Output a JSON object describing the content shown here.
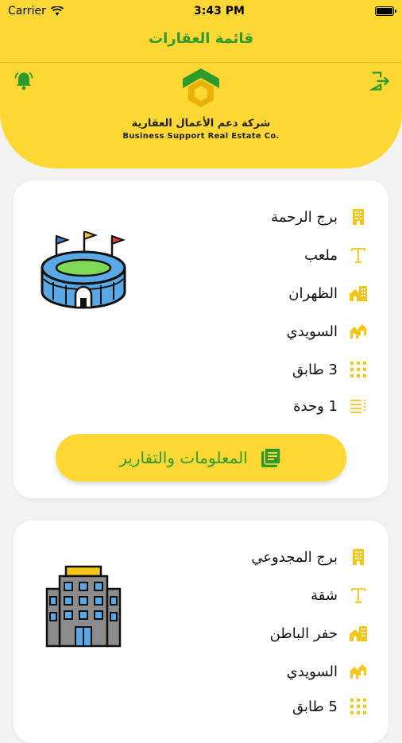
{
  "status": {
    "carrier": "Carrier",
    "time": "3:43 PM"
  },
  "header": {
    "title": "قائمة العقارات",
    "company_ar": "شركة دعم الأعمال العقارية",
    "company_en": "Business Support Real Estate Co."
  },
  "properties": [
    {
      "name": "برج الرحمة",
      "type": "ملعب",
      "district": "الظهران",
      "area": "السويدي",
      "floors": "3 طابق",
      "units": "1 وحدة",
      "button_label": "المعلومات والتقارير"
    },
    {
      "name": "برج المجدوعي",
      "type": "شقة",
      "district": "حفر الباطن",
      "area": "السويدي",
      "floors": "5 طابق"
    }
  ],
  "colors": {
    "brand_yellow": "#fdd835",
    "brand_green": "#2e9a2e",
    "icon_yellow": "#f5c518"
  }
}
